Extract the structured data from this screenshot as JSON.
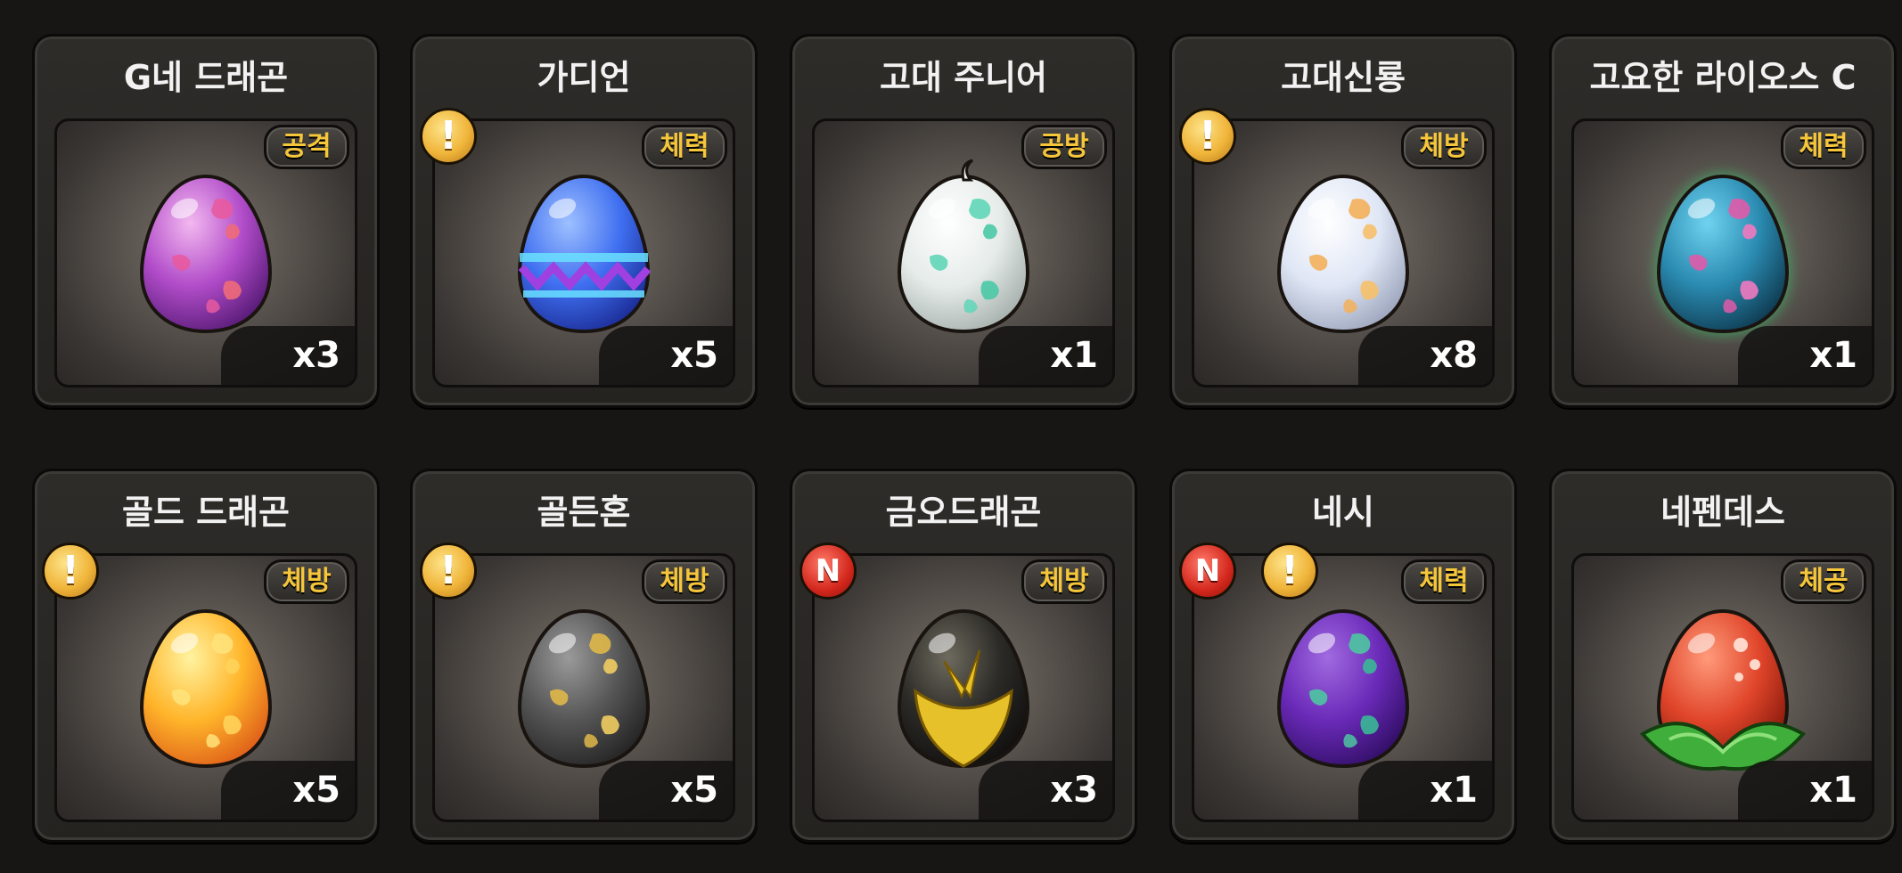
{
  "colors": {
    "background": "#171614",
    "tag_text": "#f5c53a",
    "count_text": "#ffffff",
    "warning_badge": "#f0b53a",
    "new_badge": "#d3271c"
  },
  "items": [
    {
      "name": "G네 드래곤",
      "tag": "공격",
      "count": "x3",
      "badges": [],
      "egg_icon": "purple-spotted-egg"
    },
    {
      "name": "가디언",
      "tag": "체력",
      "count": "x5",
      "badges": [
        {
          "type": "warning",
          "symbol": "!"
        }
      ],
      "egg_icon": "blue-zigzag-egg"
    },
    {
      "name": "고대 주니어",
      "tag": "공방",
      "count": "x1",
      "badges": [],
      "egg_icon": "white-mint-spotted-egg"
    },
    {
      "name": "고대신룡",
      "tag": "체방",
      "count": "x8",
      "badges": [
        {
          "type": "warning",
          "symbol": "!"
        }
      ],
      "egg_icon": "white-orange-spotted-egg"
    },
    {
      "name": "고요한 라이오스 C",
      "tag": "체력",
      "count": "x1",
      "badges": [],
      "egg_icon": "teal-glowing-egg"
    },
    {
      "name": "골드 드래곤",
      "tag": "체방",
      "count": "x5",
      "badges": [
        {
          "type": "warning",
          "symbol": "!"
        }
      ],
      "egg_icon": "golden-egg"
    },
    {
      "name": "골든혼",
      "tag": "체방",
      "count": "x5",
      "badges": [
        {
          "type": "warning",
          "symbol": "!"
        }
      ],
      "egg_icon": "gray-gold-spotted-egg"
    },
    {
      "name": "금오드래곤",
      "tag": "체방",
      "count": "x3",
      "badges": [
        {
          "type": "new",
          "symbol": "N"
        }
      ],
      "egg_icon": "black-gold-egg"
    },
    {
      "name": "네시",
      "tag": "체력",
      "count": "x1",
      "badges": [
        {
          "type": "new",
          "symbol": "N"
        },
        {
          "type": "warning",
          "symbol": "!"
        }
      ],
      "egg_icon": "purple-green-spotted-egg"
    },
    {
      "name": "네펜데스",
      "tag": "체공",
      "count": "x1",
      "badges": [],
      "egg_icon": "red-leaf-egg"
    }
  ]
}
